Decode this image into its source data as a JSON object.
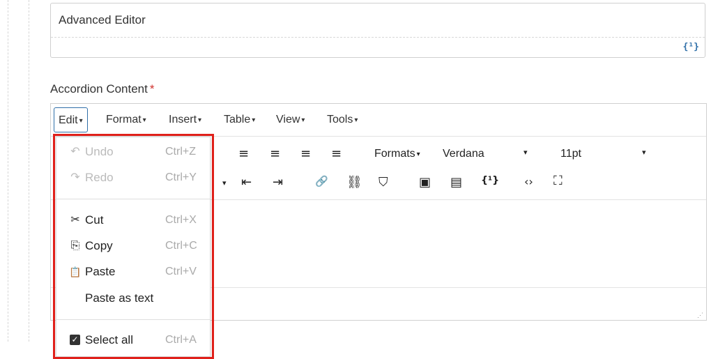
{
  "advanced_editor": {
    "title": "Advanced Editor",
    "icon": "template-icon",
    "icon_glyph": "{¹}"
  },
  "field": {
    "label": "Accordion Content",
    "required_mark": "*"
  },
  "menubar": {
    "items": [
      {
        "label": "Edit",
        "caret": "▾"
      },
      {
        "label": "Format",
        "caret": "▾"
      },
      {
        "label": "Insert",
        "caret": "▾"
      },
      {
        "label": "Table",
        "caret": "▾"
      },
      {
        "label": "View",
        "caret": "▾"
      },
      {
        "label": "Tools",
        "caret": "▾"
      }
    ]
  },
  "toolbar": {
    "formats_label": "Formats",
    "formats_caret": "▾",
    "font_family": "Verdana",
    "font_family_caret": "▾",
    "font_size": "11pt",
    "font_size_caret": "▾",
    "list_caret": "▾",
    "icons": {
      "align_left": "≡",
      "align_center": "≡",
      "align_right": "≡",
      "justify": "≡",
      "outdent": "⇤",
      "indent": "⇥",
      "link": "🔗",
      "unlink": "⛓",
      "bookmark": "⛉",
      "image": "▣",
      "media": "▤",
      "template": "{¹}",
      "code": "‹›",
      "fullscreen": "⛶"
    }
  },
  "statusbar": {
    "resize_glyph": "⋰"
  },
  "edit_menu": {
    "items": [
      {
        "icon": "undo-icon",
        "glyph": "↶",
        "label": "Undo",
        "shortcut": "Ctrl+Z",
        "disabled": true
      },
      {
        "icon": "redo-icon",
        "glyph": "↷",
        "label": "Redo",
        "shortcut": "Ctrl+Y",
        "disabled": true
      },
      {
        "icon": "cut-icon",
        "glyph": "✂",
        "label": "Cut",
        "shortcut": "Ctrl+X",
        "disabled": false
      },
      {
        "icon": "copy-icon",
        "glyph": "⎘",
        "label": "Copy",
        "shortcut": "Ctrl+C",
        "disabled": false
      },
      {
        "icon": "paste-icon",
        "glyph": "📋",
        "label": "Paste",
        "shortcut": "Ctrl+V",
        "disabled": false
      },
      {
        "icon": "",
        "glyph": "",
        "label": "Paste as text",
        "shortcut": "",
        "disabled": false
      },
      {
        "icon": "checkbox-icon",
        "glyph": "✓",
        "label": "Select all",
        "shortcut": "Ctrl+A",
        "disabled": false
      }
    ]
  },
  "colors": {
    "highlight": "#e0201a",
    "active_menu_border": "#2f6fa8",
    "required": "#d0312d"
  }
}
